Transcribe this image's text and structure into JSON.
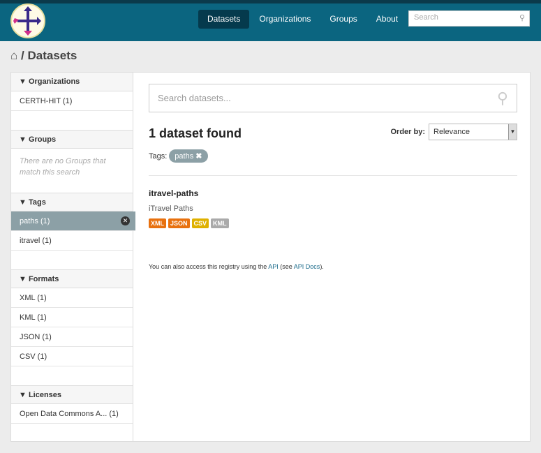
{
  "nav": {
    "items": [
      "Datasets",
      "Organizations",
      "Groups",
      "About"
    ],
    "search_placeholder": "Search"
  },
  "breadcrumb": {
    "current": "Datasets",
    "sep": "/"
  },
  "sidebar": {
    "organizations": {
      "title": "Organizations",
      "items": [
        "CERTH-HIT (1)"
      ]
    },
    "groups": {
      "title": "Groups",
      "empty": "There are no Groups that match this search"
    },
    "tags": {
      "title": "Tags",
      "items": [
        "paths (1)",
        "itravel (1)"
      ]
    },
    "formats": {
      "title": "Formats",
      "items": [
        "XML (1)",
        "KML (1)",
        "JSON (1)",
        "CSV (1)"
      ]
    },
    "licenses": {
      "title": "Licenses",
      "items": [
        "Open Data Commons A... (1)"
      ]
    }
  },
  "main": {
    "search_placeholder": "Search datasets...",
    "count": "1 dataset found",
    "order_label": "Order by:",
    "order_value": "Relevance",
    "tags_label": "Tags:",
    "active_tag": "paths",
    "dataset": {
      "title": "itravel-paths",
      "description": "iTravel Paths",
      "formats": [
        {
          "label": "XML",
          "color": "#e8710f"
        },
        {
          "label": "JSON",
          "color": "#e8710f"
        },
        {
          "label": "CSV",
          "color": "#dfb100"
        },
        {
          "label": "KML",
          "color": "#aaaaaa"
        }
      ]
    },
    "api": {
      "pre": "You can also access this registry using the ",
      "api": "API",
      "mid": " (see ",
      "docs": "API Docs",
      "post": ")."
    }
  }
}
